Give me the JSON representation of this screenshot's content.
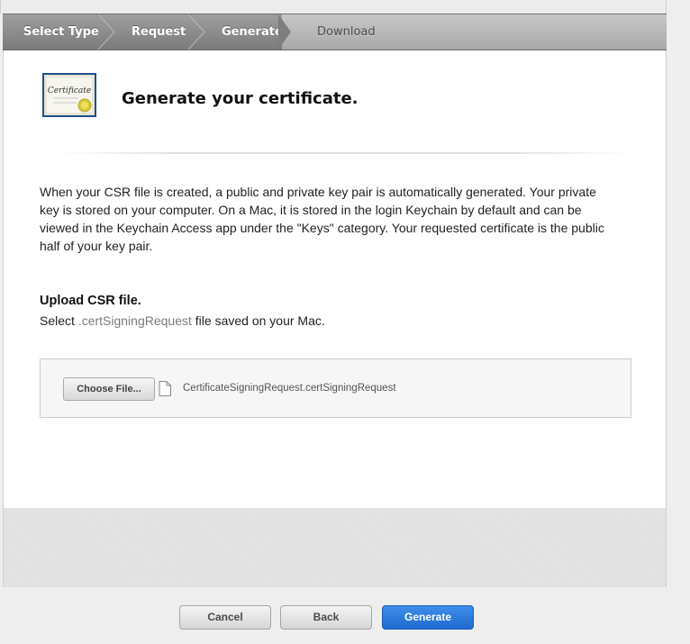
{
  "steps": {
    "items": [
      {
        "label": "Select Type"
      },
      {
        "label": "Request"
      },
      {
        "label": "Generate"
      },
      {
        "label": "Download"
      }
    ]
  },
  "header": {
    "title": "Generate your certificate.",
    "icon_text": "Certificate",
    "icon": "certificate-icon"
  },
  "description": "When your CSR file is created, a public and private key pair is automatically generated. Your private key is stored on your computer. On a Mac, it is stored in the login Keychain by default and can be viewed in the Keychain Access app under the \"Keys\" category. Your requested certificate is the public half of your key pair.",
  "upload": {
    "heading": "Upload CSR file.",
    "sub_prefix": "Select ",
    "sub_ext": ".certSigningRequest",
    "sub_suffix": " file saved on your Mac.",
    "choose_label": "Choose File...",
    "file_name": "CertificateSigningRequest.certSigningRequest",
    "file_icon": "document-icon"
  },
  "footer": {
    "cancel_label": "Cancel",
    "back_label": "Back",
    "generate_label": "Generate"
  },
  "colors": {
    "accent": "#2a7be0",
    "step_bar": "#8a8a8a"
  }
}
